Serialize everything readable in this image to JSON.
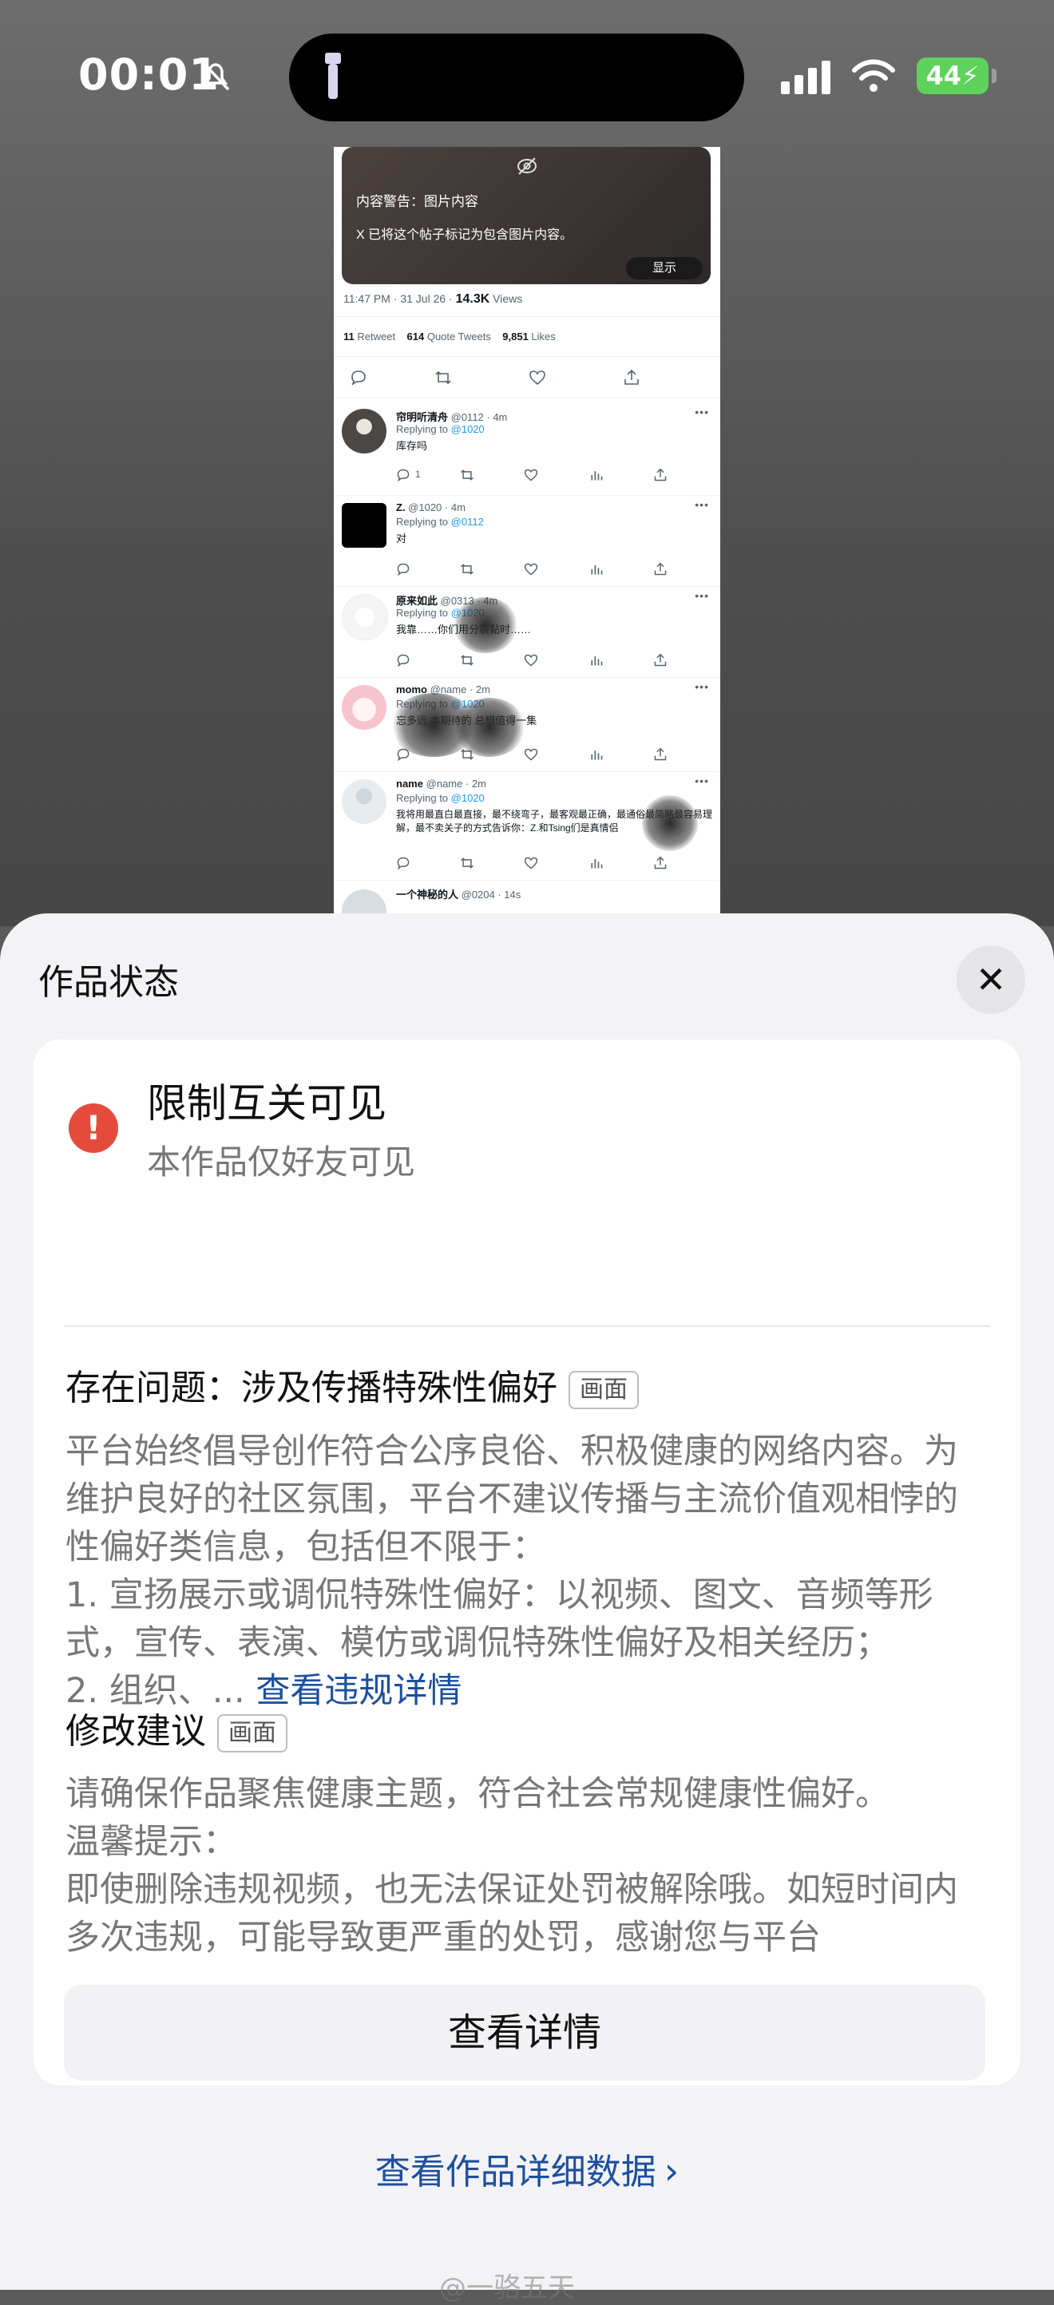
{
  "status_bar": {
    "time": "00:01",
    "battery": "44"
  },
  "tweet": {
    "warning_title": "内容警告：图片内容",
    "warning_text": "X 已将这个帖子标记为包含图片内容。",
    "warning_show": "显示",
    "timestamp": "11:47 PM · 31 Jul 26 · ",
    "views_count": "14.3K",
    "views_label": " Views",
    "retweets_count": "11",
    "retweets_label": " Retweet",
    "quotes_count": "614",
    "quotes_label": " Quote Tweets",
    "likes_count": "9,851",
    "likes_label": " Likes",
    "replies": [
      {
        "name": "帘明听清舟",
        "handle": " @0112 · 4m",
        "replying": "Replying to ",
        "to": "@1020",
        "text": "库存吗",
        "reply_count": "1"
      },
      {
        "name": "Z.",
        "handle": " @1020 · 4m",
        "replying": "Replying to ",
        "to": "@0112",
        "text": "对",
        "reply_count": ""
      },
      {
        "name": "原来如此",
        "handle": " @0313 · 4m",
        "replying": "Replying to ",
        "to": "@1020",
        "text": "我靠……你们用分裂黏时……",
        "reply_count": ""
      },
      {
        "name": "momo",
        "handle": " @name · 2m",
        "replying": "Replying to ",
        "to": "@1020",
        "text": "忘多远 本期待的 总想值得一集",
        "reply_count": ""
      },
      {
        "name": "name",
        "handle": " @name · 2m",
        "replying": "Replying to ",
        "to": "@1020",
        "text": "我将用最直白最直接，最不绕弯子，最客观最正确，最通俗最简略最容易理解，最不卖关子的方式告诉你：Z.和Tsing们是真情侣",
        "reply_count": ""
      },
      {
        "name": "一个神秘的人",
        "handle": " @0204 · 14s",
        "replying": "",
        "to": "",
        "text": "",
        "reply_count": ""
      }
    ]
  },
  "sheet": {
    "title": "作品状态",
    "status_title": "限制互关可见",
    "status_subtitle": "本作品仅好友可见",
    "issue_title": "存在问题：涉及传播特殊性偏好",
    "issue_tag": "画面",
    "issue_body": "平台始终倡导创作符合公序良俗、积极健康的网络内容。为维护良好的社区氛围，平台不建议传播与主流价值观相悖的性偏好类信息，包括但不限于：\n1. 宣扬展示或调侃特殊性偏好：以视频、图文、音频等形式，宣传、表演、模仿或调侃特殊性偏好及相关经历；\n2. 组织、... ",
    "issue_link": "查看违规详情",
    "suggest_title": "修改建议",
    "suggest_tag": "画面",
    "suggest_body": "请确保作品聚焦健康主题，符合社会常规健康性偏好。\n温馨提示：\n即使删除违规视频，也无法保证处罚被解除哦。如短时间内多次违规，可能导致更严重的处罚，感谢您与平台",
    "detail_button": "查看详情",
    "data_link": "查看作品详细数据",
    "close_icon": "close-icon"
  },
  "watermark": "@一骆五天",
  "colors": {
    "accent": "#1c4f9f",
    "error": "#e54b3c",
    "tweet_link": "#1d9bf0"
  }
}
